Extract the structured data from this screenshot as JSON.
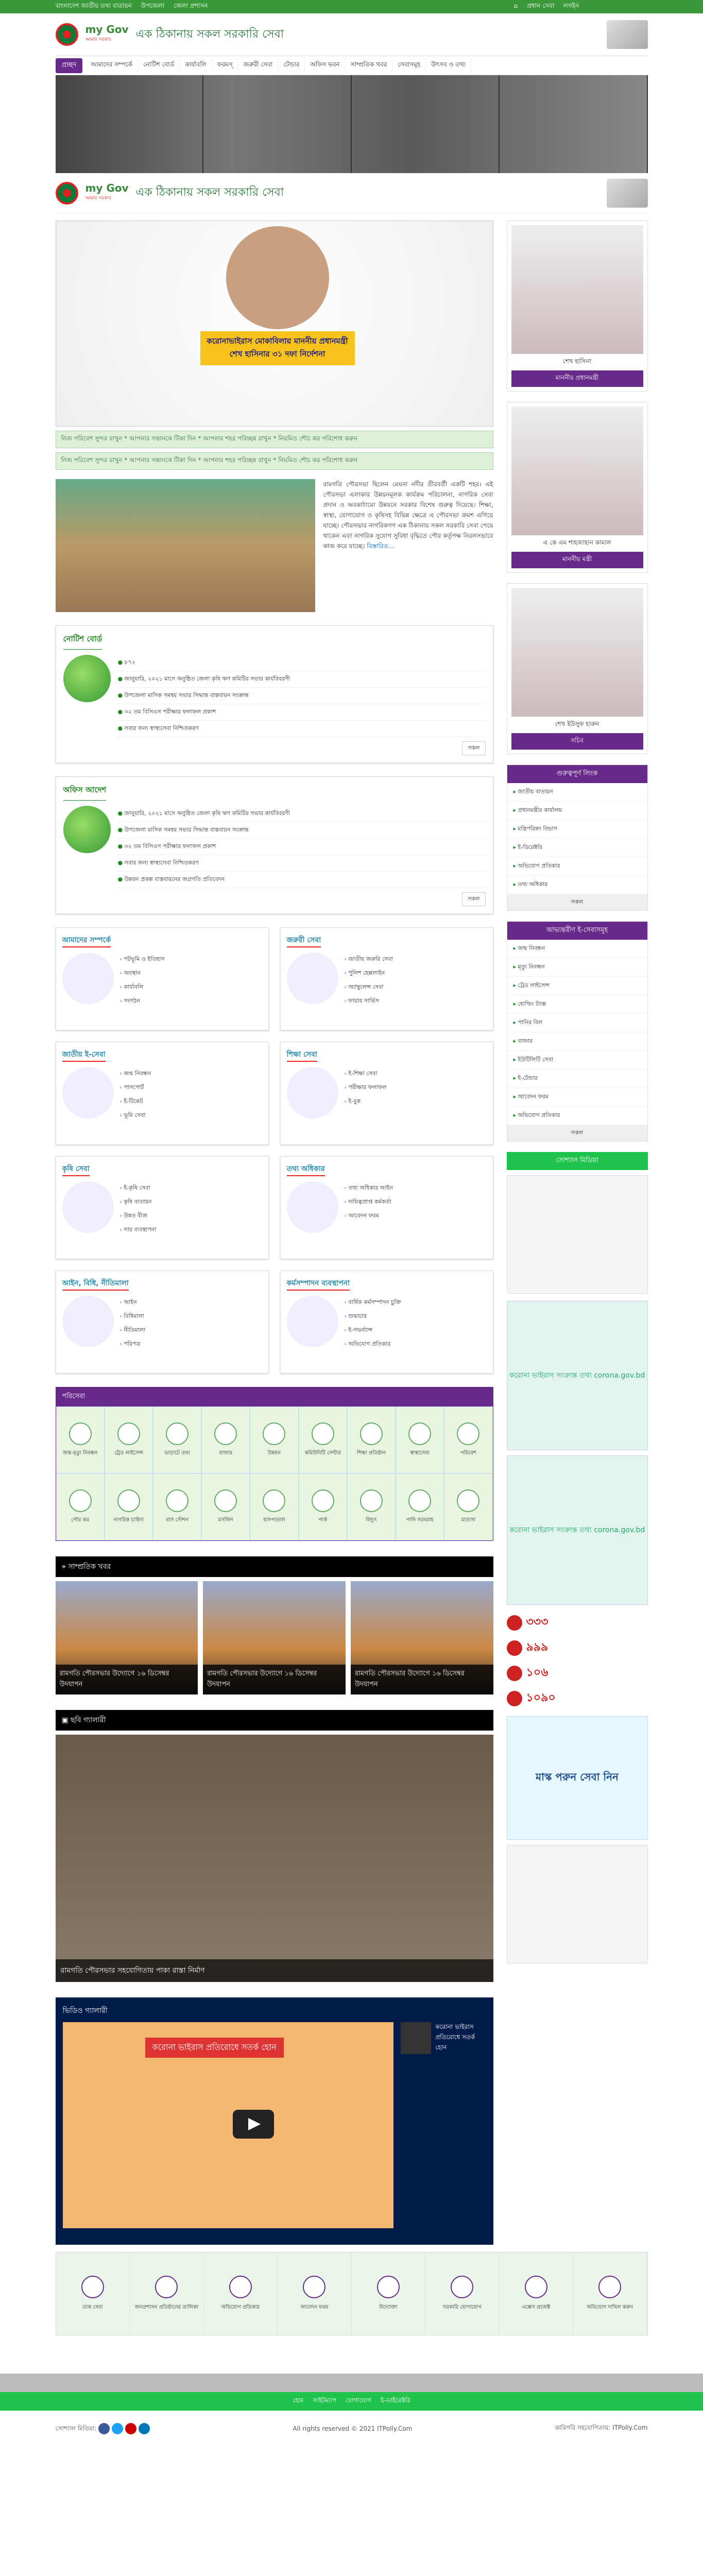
{
  "topbar": {
    "links": [
      "বাংলাদেশ জাতীয় তথ্য বাতায়ন",
      "উপজেলা",
      "জেলা প্রশাসন"
    ],
    "right": [
      "হোম",
      "প্রধান সেবা",
      "লগইন"
    ]
  },
  "header": {
    "brand": "my Gov",
    "brand_sub": "আমার সরকার",
    "slogan": "এক ঠিকানায় সকল সরকারি সেবা"
  },
  "nav": {
    "home": "প্রচ্ছদ",
    "items": [
      "আমাদের সম্পর্কে",
      "নোটিশ বোর্ড",
      "কার্যাবলি",
      "ফরমস্‌",
      "জরুরী সেবা",
      "টেন্ডার",
      "অফিস ভবন",
      "সাম্প্রতিক খবর",
      "সেবাসমূহ",
      "উৎসব ও তথ্য"
    ]
  },
  "hero": {
    "caption": "করোনাভাইরাস মোকাবিলায় মাননীয় প্রধানমন্ত্রী শেখ হাসিনার ৩১ দফা নির্দেশনা"
  },
  "marquee": [
    "নিজ পরিবেশ সুন্দর রাখুন * আপনার সন্তানকে টিকা দিন * আপনার শহর পরিচ্ছন্ন রাখুন * নিয়মিত শৌচ কর পরিশোধ করুন",
    "নিজ পরিবেশ সুন্দর রাখুন * আপনার সন্তানকে টিকা দিন * আপনার শহর পরিচ্ছন্ন রাখুন * নিয়মিত শৌচ কর পরিশোধ করুন"
  ],
  "intro": {
    "text": "রামগতি পৌরসভা ছিলেন মেঘনা নদীর তীরবর্তী একটি শহর। এই পৌরসভা এলাকার উন্নয়নমূলক কার্যক্রম পরিচালনা, নাগরিক সেবা প্রদান ও অবকাঠামো উন্নয়নে সরকার বিশেষ গুরুত্ব দিয়েছে। শিক্ষা, স্বাস্থ্য, যোগাযোগ ও কৃষিসহ বিভিন্ন ক্ষেত্রে এ পৌরসভা ক্রমশ এগিয়ে যাচ্ছে। পৌরসভার নাগরিকগণ এক ঠিকানায় সকল সরকারি সেবা পেয়ে থাকেন এবং নাগরিক সুযোগ সুবিধা বৃদ্ধিতে পৌর কর্তৃপক্ষ নিরলসভাবে কাজ করে যাচ্ছে।",
    "more": "বিস্তারিত..."
  },
  "notice": {
    "title": "নোটিশ বোর্ড",
    "items": [
      "৮৭২",
      "জানুয়ারি, ২০২১ মাসে অনুষ্ঠিত জেলা কৃষি ঋণ কমিটির সভার কার্যবিবরণী",
      "উপজেলা মাসিক সমন্বয় সভার সিদ্ধান্ত বাস্তবায়ন সংক্রান্ত",
      "৩২ তম বিসিএস পরীক্ষার ফলাফল প্রকাশ",
      "সবার জন্য স্বাস্থ্যসেবা নিশ্চিতকরণ"
    ],
    "all": "সকল"
  },
  "office": {
    "title": "অফিস আদেশ",
    "items": [
      "জানুয়ারি, ২০২১ মাসে অনুষ্ঠিত জেলা কৃষি ঋণ কমিটির সভার কার্যবিবরণী",
      "উপজেলা মাসিক সমন্বয় সভার সিদ্ধান্ত বাস্তবায়ন সংক্রান্ত",
      "৩২ তম বিসিএস পরীক্ষার ফলাফল প্রকাশ",
      "সবার জন্য স্বাস্থ্যসেবা নিশ্চিতকরণ",
      "উন্নয়ন প্রকল্প বাস্তবায়নের অগ্রগতি প্রতিবেদন"
    ],
    "all": "সকল"
  },
  "services": [
    {
      "title": "আমাদের সম্পর্কে",
      "items": [
        "পটভূমি ও ইতিহাস",
        "অবস্থান",
        "কার্যাবলি",
        "সংগঠন"
      ]
    },
    {
      "title": "জরুরী সেবা",
      "items": [
        "জাতীয় জরুরি সেবা",
        "পুলিশ হেল্পলাইন",
        "অ্যাম্বুলেন্স সেবা",
        "ফায়ার সার্ভিস"
      ]
    },
    {
      "title": "জাতীয় ই-সেবা",
      "items": [
        "জন্ম নিবন্ধন",
        "পাসপোর্ট",
        "ই-টিকেট",
        "ভূমি সেবা"
      ]
    },
    {
      "title": "শিক্ষা সেবা",
      "items": [
        "ই-শিক্ষা সেবা",
        "পরীক্ষার ফলাফল",
        "ই-বুক"
      ]
    },
    {
      "title": "কৃষি সেবা",
      "items": [
        "ই-কৃষি সেবা",
        "কৃষি বাতায়ন",
        "উন্নত বীজ",
        "সার ব্যবস্থাপনা"
      ]
    },
    {
      "title": "তথ্য অধিকার",
      "items": [
        "তথ্য অধিকার আইন",
        "দায়িত্বপ্রাপ্ত কর্মকর্তা",
        "আবেদন ফরম"
      ]
    },
    {
      "title": "আইন, বিধি, নীতিমালা",
      "items": [
        "আইন",
        "বিধিমালা",
        "নীতিমালা",
        "পরিপত্র"
      ]
    },
    {
      "title": "কর্মসম্পাদন ব্যবস্থাপনা",
      "items": [
        "বার্ষিক কর্মসম্পাদন চুক্তি",
        "শুদ্ধাচার",
        "ই-গভর্ন্যান্স",
        "অভিযোগ প্রতিকার"
      ]
    }
  ],
  "portal": {
    "title": "পরিসেবা",
    "items": [
      "জন্ম-মৃত্যু নিবন্ধন",
      "ট্রেড লাইসেন্স",
      "ভাড়াটে তথ্য",
      "বাজার",
      "উন্নয়ন",
      "কমিউনিটি সেন্টার",
      "শিক্ষা প্রতিষ্ঠান",
      "স্বাস্থ্যসেবা",
      "পরিবেশ",
      "পৌর কর",
      "নাগরিক চাহিদা",
      "বাস স্টেশন",
      "মসজিদ",
      "হাসপাতাল",
      "পার্ক",
      "বিদ্যুৎ",
      "পানি সরবরাহ",
      "মাদ্রাসা"
    ]
  },
  "news": {
    "title": "সাম্প্রতিক খবর",
    "items": [
      "রামগতি পৌরসভার উদ্যোগে ১৬ ডিসেম্বর উদযাপন",
      "রামগতি পৌরসভার উদ্যোগে ১৬ ডিসেম্বর উদযাপন",
      "রামগতি পৌরসভার উদ্যোগে ১৬ ডিসেম্বর উদযাপন"
    ]
  },
  "gallery": {
    "title": "ছবি গ্যালারী",
    "caption": "রামগতি পৌরসভার সহযোগিতায় পাকা রাস্তা নির্মাণ"
  },
  "video": {
    "title": "ভিডিও গ্যালারী",
    "caption": "করোনা ভাইরাস প্রতিরোধে সতর্ক হোন",
    "side": "করোনা ভাইরাস প্রতিরোধে সতর্ক হোন"
  },
  "icons": [
    "ডাক সেবা",
    "জনপ্রশাসন প্রতিষ্ঠানের তালিকা",
    "অভিযোগ প্রতিকার",
    "আবেদন ফরম",
    "উদ্যোক্তা",
    "সরকারি যোগাযোগ",
    "এক্সেস প্রজেক্ট",
    "অভিযোগ দাখিল করুন"
  ],
  "officials": [
    {
      "name": "শেখ হাসিনা",
      "role": "মাননীয় প্রধানমন্ত্রী"
    },
    {
      "name": "এ কে এম শাহজাহান কামাল",
      "role": "মাননীয় মন্ত্রী"
    },
    {
      "name": "শেখ ইউসুফ হারুন",
      "role": "সচিব"
    }
  ],
  "links1": {
    "title": "গুরুত্বপূর্ণ লিংক",
    "items": [
      "জাতীয় বাতায়ন",
      "প্রধানমন্ত্রীর কার্যালয়",
      "মন্ত্রিপরিষদ বিভাগ",
      "ই-ডিরেক্টরি",
      "অভিযোগ প্রতিকার",
      "তথ্য অধিকার"
    ],
    "all": "সকল"
  },
  "links2": {
    "title": "আভ্যন্তরীণ ই-সেবাসমূহ",
    "items": [
      "জন্ম নিবন্ধন",
      "মৃত্যু নিবন্ধন",
      "ট্রেড লাইসেন্স",
      "হোল্ডিং ট্যাক্স",
      "পানির বিল",
      "বাজার",
      "ইউটিলিটি সেবা",
      "ই-টেন্ডার",
      "আবেদন ফরম",
      "অভিযোগ প্রতিকার"
    ],
    "all": "সকল"
  },
  "social_title": "সোশ্যাল মিডিয়া",
  "corona": [
    "করোনা ভাইরাস সংক্রান্ত তথ্য corona.gov.bd",
    "করোনা ভাইরাস সংক্রান্ত তথ্য corona.gov.bd"
  ],
  "hotlines": [
    "৩৩৩",
    "৯৯৯",
    "১০৬",
    "১০৯০"
  ],
  "mask": "মাস্ক পরুন সেবা নিন",
  "footer": {
    "links": [
      "হোম",
      "সাইটম্যাপ",
      "যোগাযোগ",
      "ই-ডাইরেক্টরি"
    ],
    "social_label": "সোশ্যাল মিডিয়া:",
    "copyright": "All rights reserved © 2021 ITPolly.Com",
    "credit": "কারিগরি সহযোগিতায়: ITPolly.Com"
  }
}
